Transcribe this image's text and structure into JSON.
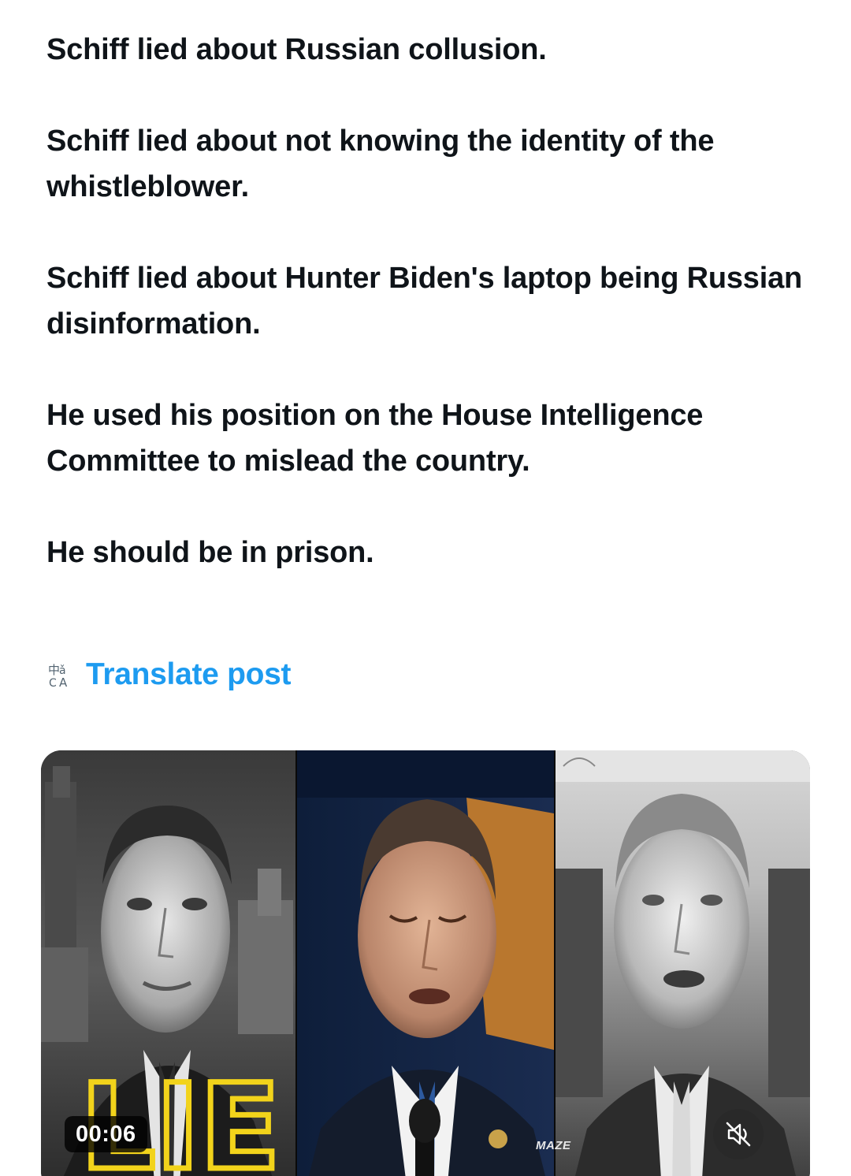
{
  "post": {
    "paragraphs": [
      "Schiff lied about Russian collusion.",
      "Schiff lied about not knowing the identity of the whistleblower.",
      "Schiff lied about Hunter Biden's laptop being Russian disinformation.",
      "He used his position on the House Intelligence Committee to mislead the country.",
      "He should be in prison."
    ],
    "translate_label": "Translate post"
  },
  "media": {
    "timer": "00:06",
    "stamp_text": "LIE",
    "watermark": "MAZE",
    "mute_icon": "speaker-muted-icon"
  },
  "colors": {
    "text": "#0f1419",
    "link": "#1d9bf0",
    "stamp": "#f2d31b"
  }
}
